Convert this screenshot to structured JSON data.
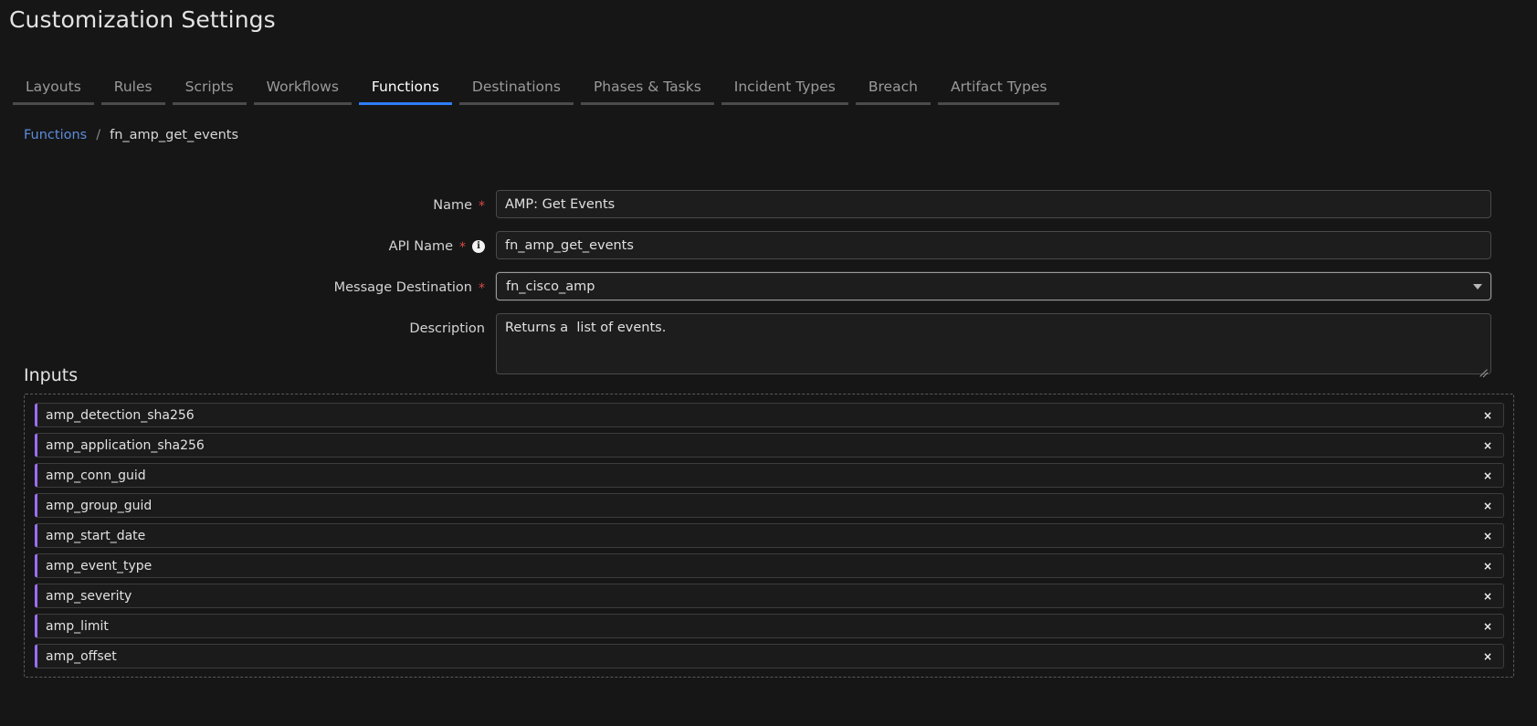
{
  "page": {
    "title": "Customization Settings"
  },
  "tabs": [
    {
      "label": "Layouts",
      "active": false
    },
    {
      "label": "Rules",
      "active": false
    },
    {
      "label": "Scripts",
      "active": false
    },
    {
      "label": "Workflows",
      "active": false
    },
    {
      "label": "Functions",
      "active": true
    },
    {
      "label": "Destinations",
      "active": false
    },
    {
      "label": "Phases & Tasks",
      "active": false
    },
    {
      "label": "Incident Types",
      "active": false
    },
    {
      "label": "Breach",
      "active": false
    },
    {
      "label": "Artifact Types",
      "active": false
    }
  ],
  "breadcrumb": {
    "root": "Functions",
    "separator": "/",
    "current": "fn_amp_get_events"
  },
  "form": {
    "name": {
      "label": "Name",
      "required": "*",
      "value": "AMP: Get Events",
      "placeholder": ""
    },
    "api_name": {
      "label": "API Name",
      "required": "*",
      "info_icon": "info-icon",
      "value": "fn_amp_get_events",
      "placeholder": ""
    },
    "message_destination": {
      "label": "Message Destination",
      "required": "*",
      "value": "fn_cisco_amp",
      "caret_icon": "chevron-down-icon"
    },
    "description": {
      "label": "Description",
      "value": "Returns a  list of events.",
      "placeholder": ""
    }
  },
  "inputs": {
    "heading": "Inputs",
    "remove_label": "×",
    "items": [
      {
        "name": "amp_detection_sha256"
      },
      {
        "name": "amp_application_sha256"
      },
      {
        "name": "amp_conn_guid"
      },
      {
        "name": "amp_group_guid"
      },
      {
        "name": "amp_start_date"
      },
      {
        "name": "amp_event_type"
      },
      {
        "name": "amp_severity"
      },
      {
        "name": "amp_limit"
      },
      {
        "name": "amp_offset"
      }
    ]
  },
  "colors": {
    "background": "#161616",
    "accent_blue": "#2d7ff9",
    "link_blue": "#5b8cdb",
    "input_accent_purple": "#9b6ef5",
    "required_red": "#d94a4a"
  }
}
